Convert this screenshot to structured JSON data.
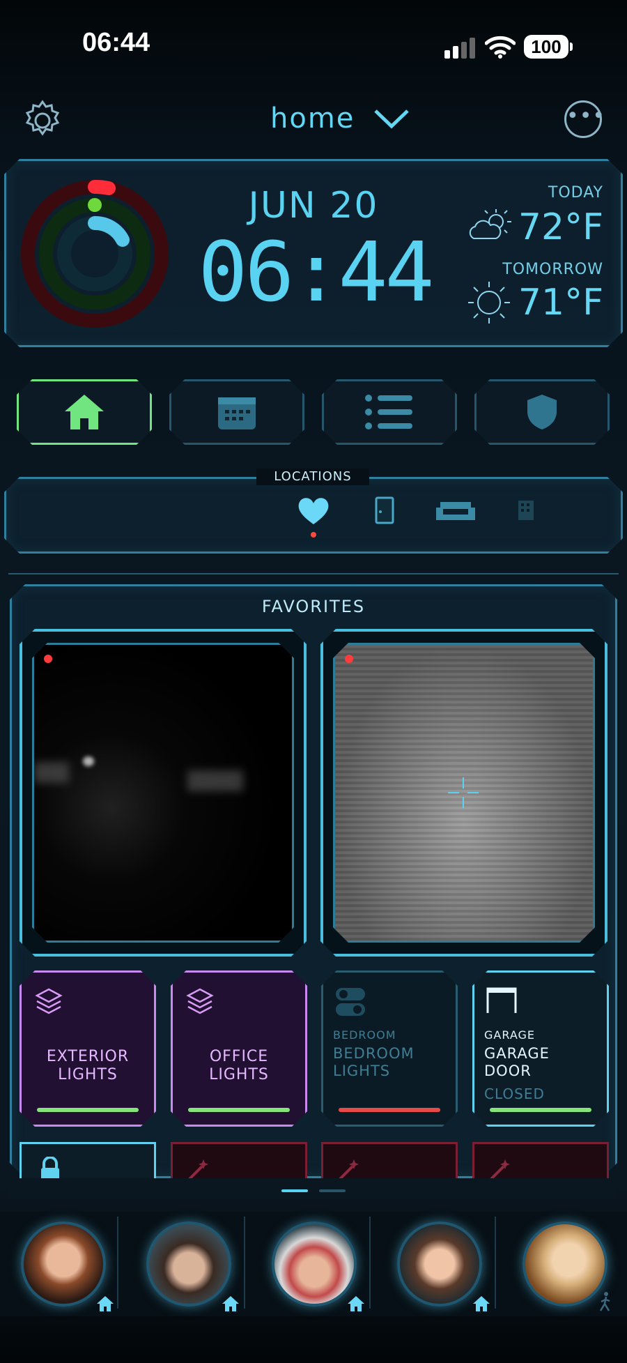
{
  "status_bar": {
    "time": "06:44",
    "battery": "100"
  },
  "header": {
    "title": "home"
  },
  "info": {
    "date": "JUN 20",
    "time": "06:44",
    "today_label": "TODAY",
    "today_temp": "72°F",
    "tomorrow_label": "TOMORROW",
    "tomorrow_temp": "71°F"
  },
  "locations": {
    "label": "LOCATIONS"
  },
  "favorites": {
    "title": "FAVORITES",
    "tiles": [
      {
        "name": "EXTERIOR\nLIGHTS"
      },
      {
        "name": "OFFICE\nLIGHTS"
      },
      {
        "room": "BEDROOM",
        "name": "BEDROOM\nLIGHTS"
      },
      {
        "room": "GARAGE",
        "name": "GARAGE\nDOOR",
        "state": "CLOSED"
      }
    ]
  },
  "colors": {
    "accent": "#5ad3f2",
    "active_green": "#71e57f",
    "purple": "#c98af0",
    "off_red": "#e84a4a"
  }
}
